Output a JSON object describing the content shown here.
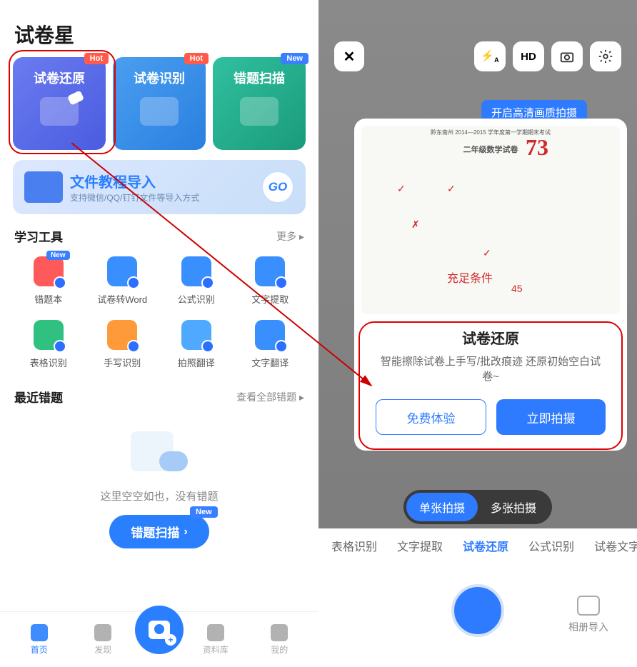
{
  "left": {
    "appTitle": "试卷星",
    "badges": {
      "hot": "Hot",
      "new": "New"
    },
    "cards": [
      {
        "title": "试卷还原",
        "badge": "hot"
      },
      {
        "title": "试卷识别",
        "badge": "hot"
      },
      {
        "title": "错题扫描",
        "badge": "new"
      }
    ],
    "fileImport": {
      "title": "文件教程导入",
      "sub": "支持微信/QQ/钉钉文件等导入方式",
      "go": "GO"
    },
    "sections": {
      "tools": {
        "title": "学习工具",
        "more": "更多 ▸"
      },
      "recent": {
        "title": "最近错题",
        "more": "查看全部错题 ▸"
      }
    },
    "tools": [
      {
        "label": "错题本",
        "color": "ic-red",
        "badge": "new"
      },
      {
        "label": "试卷转Word",
        "color": "ic-blue"
      },
      {
        "label": "公式识别",
        "color": "ic-blue"
      },
      {
        "label": "文字提取",
        "color": "ic-blue"
      },
      {
        "label": "表格识别",
        "color": "ic-green"
      },
      {
        "label": "手写识别",
        "color": "ic-orange"
      },
      {
        "label": "拍照翻译",
        "color": "ic-blue2"
      },
      {
        "label": "文字翻译",
        "color": "ic-blue"
      }
    ],
    "empty": {
      "text": "这里空空如也，没有错题",
      "button": "错题扫描"
    },
    "nav": [
      {
        "label": "首页",
        "active": true
      },
      {
        "label": "发现"
      },
      {
        "label": "资料库"
      },
      {
        "label": "我的"
      }
    ]
  },
  "right": {
    "hdLabel": "HD",
    "tip": "开启高清画质拍摄",
    "exam": {
      "title": "二年级数学试卷",
      "subtitle": "黔东南州 2014—2015 学年度第一学期期末考试",
      "score": "73"
    },
    "sheet": {
      "title": "试卷还原",
      "sub": "智能擦除试卷上手写/批改痕迹 还原初始空白试卷~",
      "trial": "免费体验",
      "shoot": "立即拍摄"
    },
    "segments": [
      "单张拍摄",
      "多张拍摄"
    ],
    "modes": [
      "表格识别",
      "文字提取",
      "试卷还原",
      "公式识别",
      "试卷文字识"
    ],
    "album": "相册导入"
  }
}
